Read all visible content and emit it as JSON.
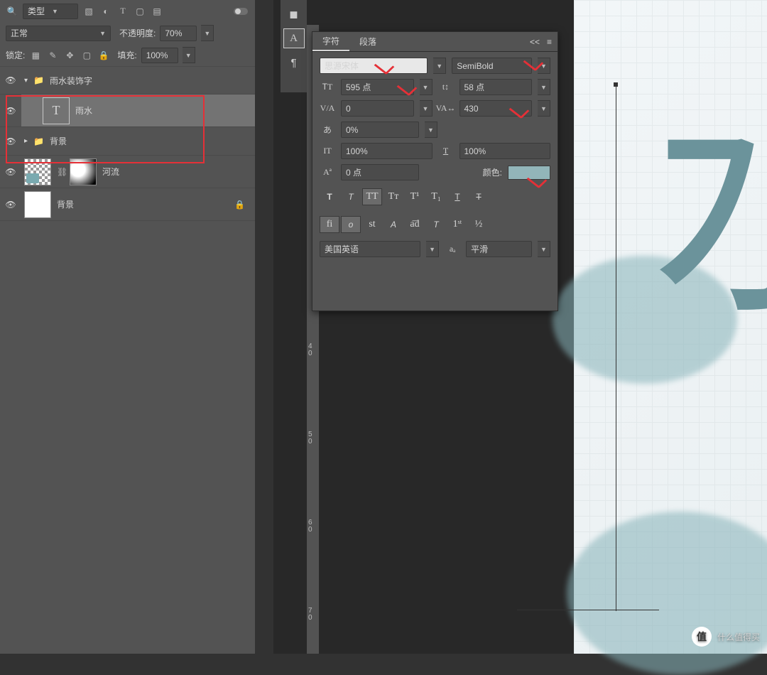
{
  "layers": {
    "search_placeholder": "类型",
    "blend_mode": "正常",
    "opacity_label": "不透明度:",
    "opacity_value": "70%",
    "lock_label": "锁定:",
    "fill_label": "填充:",
    "fill_value": "100%",
    "items": [
      {
        "name": "雨水装饰字",
        "type": "group"
      },
      {
        "name": "雨水",
        "type": "text"
      },
      {
        "name": "背景",
        "type": "group"
      },
      {
        "name": "河流",
        "type": "masked"
      },
      {
        "name": "背景",
        "type": "locked"
      }
    ]
  },
  "char": {
    "tab_char": "字符",
    "tab_para": "段落",
    "collapse": "<<",
    "font_family": "思源宋体",
    "font_weight": "SemiBold",
    "font_size": "595 点",
    "leading": "58 点",
    "kerning_va": "0",
    "tracking": "430",
    "tsume": "0%",
    "vscale": "100%",
    "hscale": "100%",
    "baseline": "0 点",
    "color_label": "颜色:",
    "color_value": "#92b5b9",
    "lang": "美国英语",
    "aa": "平滑"
  },
  "canvas": {
    "big_text": "雨水"
  },
  "ruler": [
    "4",
    "0",
    "5",
    "0",
    "6",
    "0",
    "7",
    "0"
  ],
  "watermark": {
    "badge": "值",
    "text": "什么值得买"
  }
}
